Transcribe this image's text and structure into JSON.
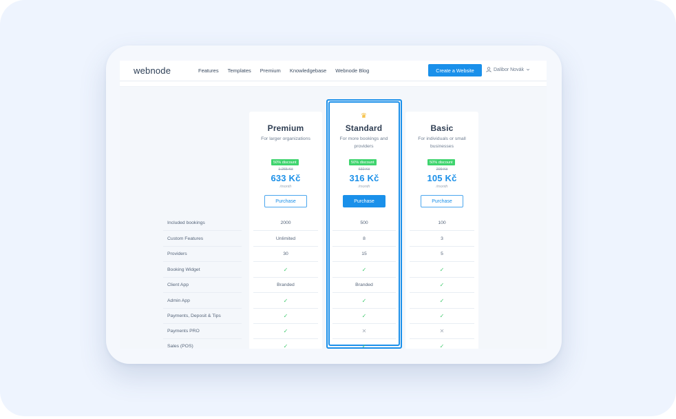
{
  "navbar": {
    "logo": "webnode",
    "links": [
      "Features",
      "Templates",
      "Premium",
      "Knowledgebase",
      "Webnode Blog"
    ],
    "create_button": "Create a Website",
    "user_name": "Dalibor Novák",
    "user_icon": "user-icon",
    "chevron_icon": "chevron-down-icon"
  },
  "plans": [
    {
      "title": "Premium",
      "subtitle": "For larger organizations",
      "discount": "50% discount",
      "old_price": "1 265 Kč",
      "price": "633 Kč",
      "period": "/month",
      "button": "Purchase"
    },
    {
      "title": "Standard",
      "subtitle": "For more bookings and providers",
      "discount": "50% discount",
      "old_price": "632 Kč",
      "price": "316 Kč",
      "period": "/month",
      "button": "Purchase",
      "crown_icon": "crown-icon"
    },
    {
      "title": "Basic",
      "subtitle": "For individuals or small businesses",
      "discount": "50% discount",
      "old_price": "209 Kč",
      "price": "105 Kč",
      "period": "/month",
      "button": "Purchase"
    }
  ],
  "features": [
    {
      "label": "Included bookings",
      "values": [
        "2000",
        "500",
        "100"
      ]
    },
    {
      "label": "Custom Features",
      "values": [
        "Unlimited",
        "8",
        "3"
      ]
    },
    {
      "label": "Providers",
      "values": [
        "30",
        "15",
        "5"
      ]
    },
    {
      "label": "Booking Widget",
      "values": [
        "✓",
        "✓",
        "✓"
      ]
    },
    {
      "label": "Client App",
      "values": [
        "Branded",
        "Branded",
        "✓"
      ]
    },
    {
      "label": "Admin App",
      "values": [
        "✓",
        "✓",
        "✓"
      ]
    },
    {
      "label": "Payments, Deposit & Tips",
      "values": [
        "✓",
        "✓",
        "✓"
      ]
    },
    {
      "label": "Payments PRO",
      "values": [
        "✓",
        "✕",
        "✕"
      ]
    },
    {
      "label": "Sales (POS)",
      "values": [
        "✓",
        "✓",
        "✓"
      ]
    }
  ],
  "colors": {
    "accent": "#1a90ea",
    "discount_badge": "#3fd46e",
    "check": "#3fc96d",
    "crown": "#f4b524"
  }
}
